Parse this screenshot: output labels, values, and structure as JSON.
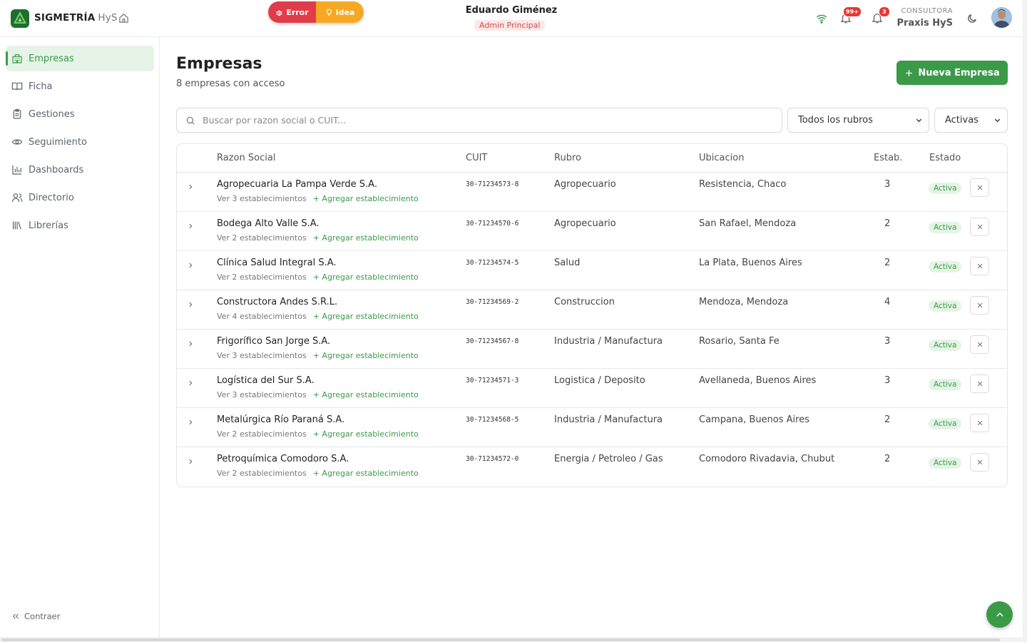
{
  "header": {
    "brand": "SIGMETRÍA",
    "brand_suffix": "HyS",
    "error_label": "Error",
    "idea_label": "Idea",
    "user_name": "Eduardo Giménez",
    "user_role": "Admin Principal",
    "notifications_badge": "99+",
    "alerts_badge": "3",
    "org_type": "CONSULTORA",
    "org_name": "Praxis HyS"
  },
  "sidebar": {
    "items": [
      {
        "label": "Empresas",
        "icon": "building-icon"
      },
      {
        "label": "Ficha",
        "icon": "book-icon"
      },
      {
        "label": "Gestiones",
        "icon": "clipboard-icon"
      },
      {
        "label": "Seguimiento",
        "icon": "eye-icon"
      },
      {
        "label": "Dashboards",
        "icon": "bar-chart-icon"
      },
      {
        "label": "Directorio",
        "icon": "users-icon"
      },
      {
        "label": "Librerías",
        "icon": "library-icon"
      }
    ],
    "collapse_label": "Contraer"
  },
  "main": {
    "title": "Empresas",
    "subtitle": "8 empresas con acceso",
    "new_button": "Nueva Empresa",
    "search_placeholder": "Buscar por razon social o CUIT...",
    "rubro_filter": "Todos los rubros",
    "estado_filter": "Activas"
  },
  "table": {
    "columns": [
      "Razon Social",
      "CUIT",
      "Rubro",
      "Ubicacion",
      "Estab.",
      "Estado"
    ],
    "rows": [
      {
        "name": "Agropecuaria La Pampa Verde S.A.",
        "sub": "Ver 3 establecimientos",
        "add": "+ Agregar establecimiento",
        "cuit": "30-71234573-8",
        "rubro": "Agropecuario",
        "ubicacion": "Resistencia, Chaco",
        "estab": "3",
        "estado": "Activa"
      },
      {
        "name": "Bodega Alto Valle S.A.",
        "sub": "Ver 2 establecimientos",
        "add": "+ Agregar establecimiento",
        "cuit": "30-71234570-6",
        "rubro": "Agropecuario",
        "ubicacion": "San Rafael, Mendoza",
        "estab": "2",
        "estado": "Activa"
      },
      {
        "name": "Clínica Salud Integral S.A.",
        "sub": "Ver 2 establecimientos",
        "add": "+ Agregar establecimiento",
        "cuit": "30-71234574-5",
        "rubro": "Salud",
        "ubicacion": "La Plata, Buenos Aires",
        "estab": "2",
        "estado": "Activa"
      },
      {
        "name": "Constructora Andes S.R.L.",
        "sub": "Ver 4 establecimientos",
        "add": "+ Agregar establecimiento",
        "cuit": "30-71234569-2",
        "rubro": "Construccion",
        "ubicacion": "Mendoza, Mendoza",
        "estab": "4",
        "estado": "Activa"
      },
      {
        "name": "Frigorífico San Jorge S.A.",
        "sub": "Ver 3 establecimientos",
        "add": "+ Agregar establecimiento",
        "cuit": "30-71234567-8",
        "rubro": "Industria / Manufactura",
        "ubicacion": "Rosario, Santa Fe",
        "estab": "3",
        "estado": "Activa"
      },
      {
        "name": "Logística del Sur S.A.",
        "sub": "Ver 3 establecimientos",
        "add": "+ Agregar establecimiento",
        "cuit": "30-71234571-3",
        "rubro": "Logistica / Deposito",
        "ubicacion": "Avellaneda, Buenos Aires",
        "estab": "3",
        "estado": "Activa"
      },
      {
        "name": "Metalúrgica Río Paraná S.A.",
        "sub": "Ver 2 establecimientos",
        "add": "+ Agregar establecimiento",
        "cuit": "30-71234568-5",
        "rubro": "Industria / Manufactura",
        "ubicacion": "Campana, Buenos Aires",
        "estab": "2",
        "estado": "Activa"
      },
      {
        "name": "Petroquímica Comodoro S.A.",
        "sub": "Ver 2 establecimientos",
        "add": "+ Agregar establecimiento",
        "cuit": "30-71234572-0",
        "rubro": "Energia / Petroleo / Gas",
        "ubicacion": "Comodoro Rivadavia, Chubut",
        "estab": "2",
        "estado": "Activa"
      }
    ]
  },
  "colors": {
    "accent": "#3a9a48",
    "error": "#e23b4a",
    "idea": "#f7a823"
  }
}
